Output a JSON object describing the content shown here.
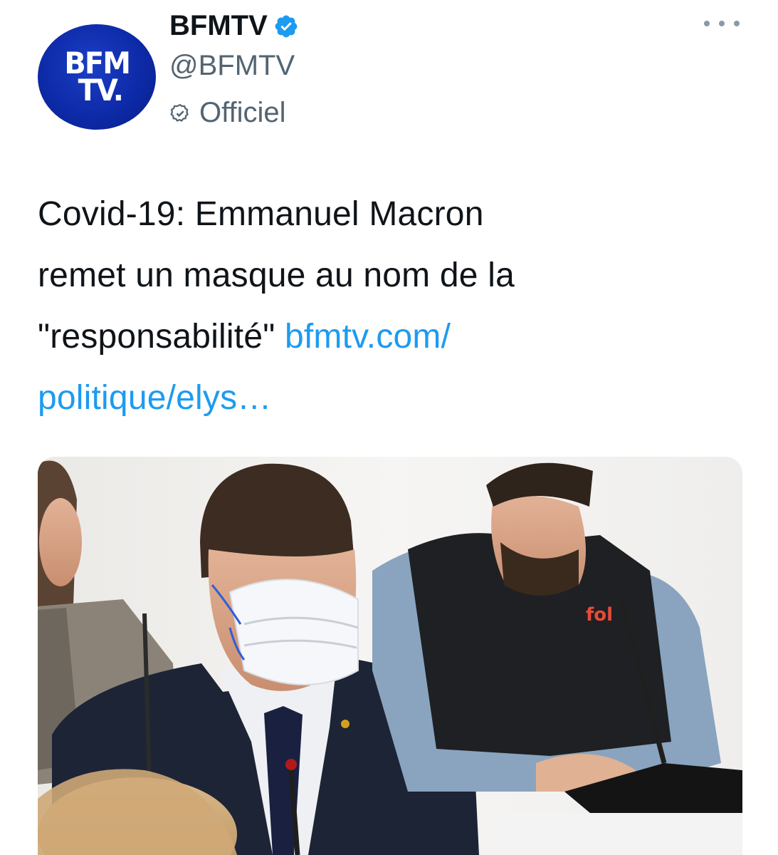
{
  "account": {
    "display_name": "BFMTV",
    "handle": "@BFMTV",
    "label": "Officiel",
    "avatar_logo_line1": "BFM",
    "avatar_logo_line2": "TV.",
    "verified": true
  },
  "tweet": {
    "text_line1": "Covid-19: Emmanuel Macron",
    "text_line2": "remet un masque au nom de la",
    "text_line3_prefix": "\"responsabilité\" ",
    "link_part1": "bfmtv.com/",
    "link_part2": "politique/elys…"
  },
  "colors": {
    "link": "#1d9bf0",
    "verified_badge": "#1d9bf0",
    "avatar_bg": "#0d2aa8",
    "secondary_text": "#536471"
  },
  "icons": {
    "verified": "verified-badge-icon",
    "official": "official-label-icon",
    "more": "more-options-icon"
  }
}
